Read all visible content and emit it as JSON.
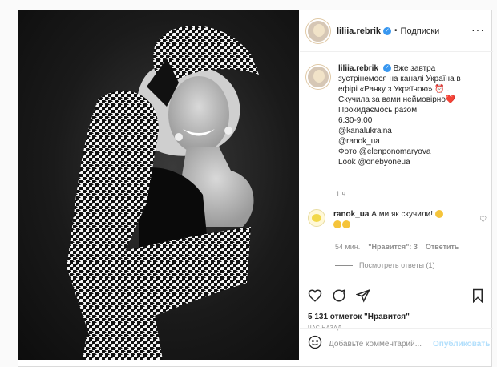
{
  "header": {
    "username": "liliia.rebrik",
    "verified_badge": "✓",
    "separator": "•",
    "follow_label": "Подписки",
    "more_label": "···"
  },
  "caption": {
    "username": "liliia.rebrik",
    "lines": [
      "Вже завтра",
      "зустрінемося на каналі Україна в",
      "ефірі «Ранку з Україною» ⏰ .",
      "Скучила за вами неймовірно❤️",
      "Прокидаємось разом!",
      "6.30-9.00",
      "@kanalukraina",
      "@ranok_ua",
      "Фото @elenponomaryova",
      "Look @onebyoneua"
    ],
    "time": "1 ч."
  },
  "comment": {
    "username": "ranok_ua",
    "text": "А ми як скучили!",
    "time": "54 мин.",
    "likes": "\"Нравится\": 3",
    "reply_label": "Ответить",
    "view_replies": "Посмотреть ответы (1)"
  },
  "actions": {
    "likes_text": "5 131 отметок \"Нравится\"",
    "posted_ago": "час назад"
  },
  "add_comment": {
    "placeholder": "Добавьте комментарий...",
    "publish_label": "Опубликовать"
  },
  "icons": [
    "heart-icon",
    "comment-icon",
    "share-icon",
    "bookmark-icon",
    "smile-icon",
    "more-icon",
    "verified-icon"
  ],
  "colors": {
    "verified": "#3897f0",
    "publish_disabled": "#b2dffc",
    "border": "#dbdbdb",
    "muted": "#8e8e8e"
  }
}
